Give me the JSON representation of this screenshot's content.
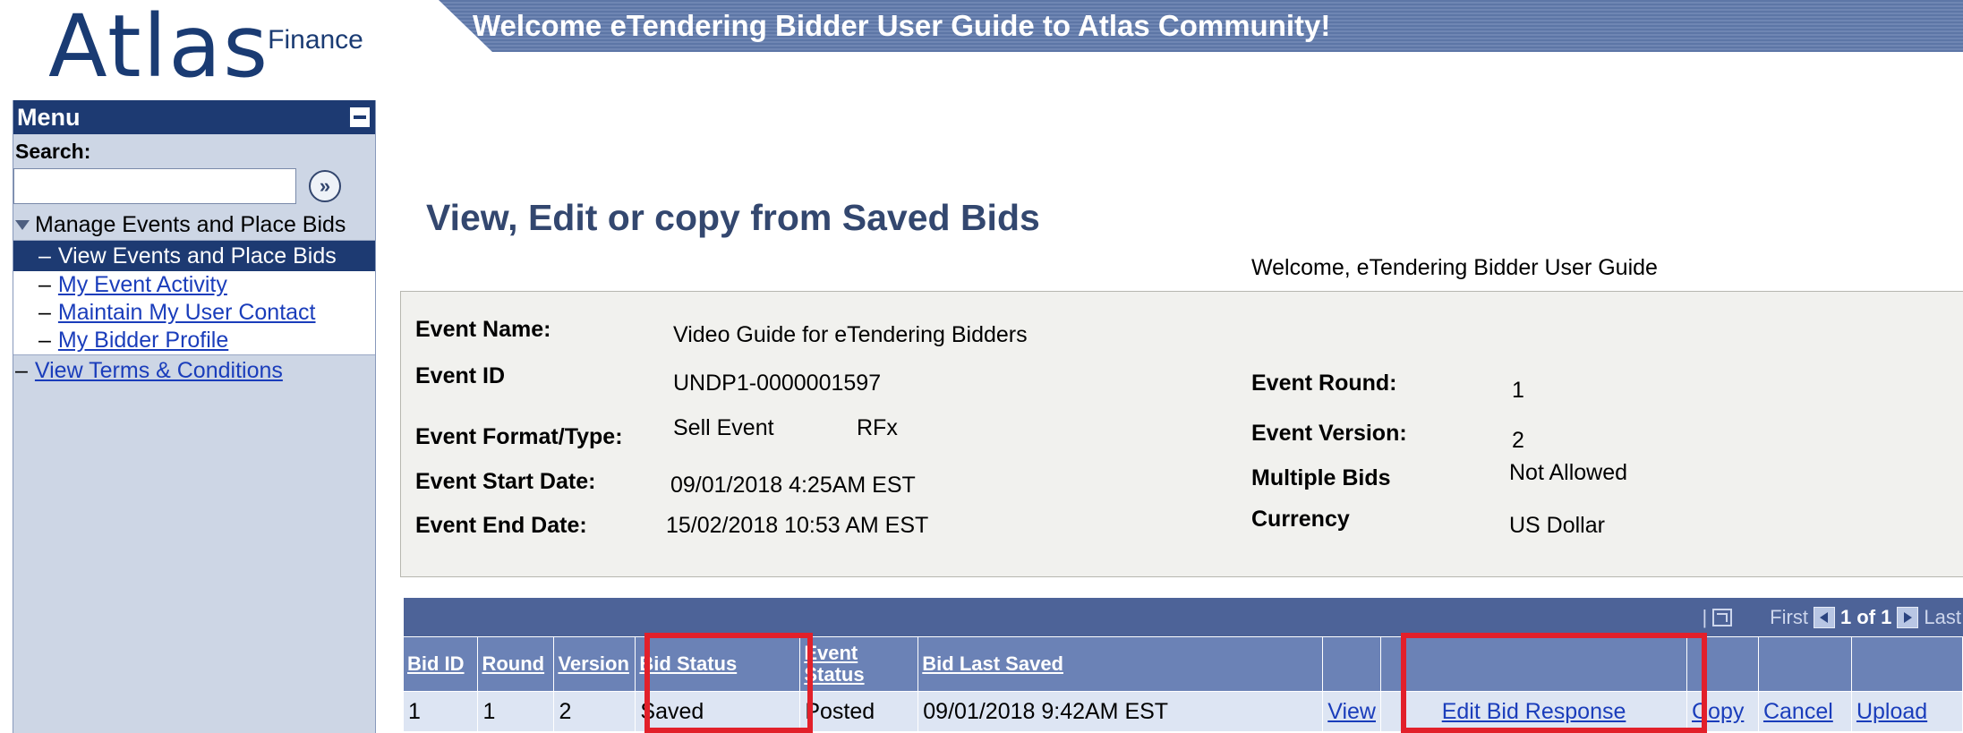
{
  "header": {
    "logo_main": "Atlas",
    "logo_sub": "Finance",
    "banner_title": "Welcome eTendering Bidder User Guide to Atlas Community!"
  },
  "sidebar": {
    "menu_title": "Menu",
    "search_label": "Search:",
    "search_value": "",
    "search_go": "»",
    "group_label": "Manage Events and Place Bids",
    "items": [
      {
        "label": "View Events and Place Bids",
        "active": true
      },
      {
        "label": "My Event Activity",
        "active": false
      },
      {
        "label": "Maintain My User Contact",
        "active": false
      },
      {
        "label": "My Bidder Profile",
        "active": false
      }
    ],
    "terms_label": "View Terms & Conditions",
    "dash": "–"
  },
  "main": {
    "page_title": "View, Edit or copy from Saved Bids",
    "welcome_user": "Welcome, eTendering Bidder User Guide"
  },
  "event": {
    "name_label": "Event Name:",
    "name_value": "Video Guide for eTendering Bidders",
    "id_label": "Event ID",
    "id_value": "UNDP1-0000001597",
    "format_label": "Event Format/Type:",
    "format_value": "Sell Event",
    "type_value": "RFx",
    "start_label": "Event Start Date:",
    "start_value": "09/01/2018  4:25AM EST",
    "end_label": "Event End Date:",
    "end_value": "15/02/2018 10:53 AM EST",
    "round_label": "Event Round:",
    "round_value": "1",
    "version_label": "Event Version:",
    "version_value": "2",
    "multiple_label": "Multiple Bids",
    "multiple_value": "Not Allowed",
    "currency_label": "Currency",
    "currency_value": "US Dollar"
  },
  "grid": {
    "separator": "|",
    "first_label": "First",
    "count_label": "1 of 1",
    "last_label": "Last",
    "headers": {
      "bid_id": "Bid ID",
      "round": "Round",
      "version": "Version",
      "bid_status": "Bid Status",
      "event_status_1": "Event",
      "event_status_2": "Status",
      "bid_last_saved": "Bid Last Saved"
    },
    "row": {
      "bid_id": "1",
      "round": "1",
      "version": "2",
      "bid_status": "Saved",
      "event_status": "Posted",
      "bid_last_saved": "09/01/2018  9:42AM EST",
      "view": "View",
      "edit": "Edit Bid Response",
      "copy": "Copy",
      "cancel": "Cancel",
      "upload": "Upload"
    }
  },
  "colors": {
    "highlight": "#e2202a",
    "menu_header": "#1d3a72",
    "grid_header": "#6b82b6",
    "link": "#1a3dbb"
  }
}
